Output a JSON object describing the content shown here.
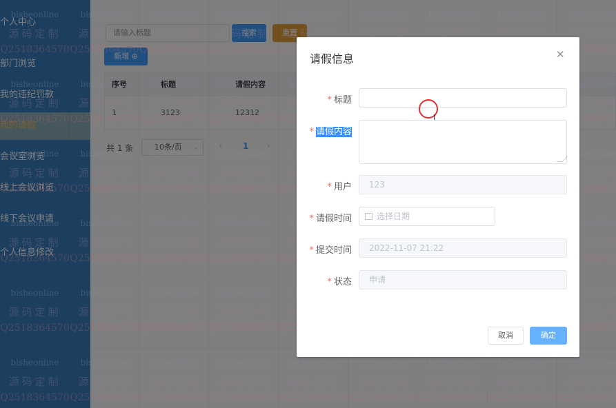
{
  "sidebar": {
    "items": [
      {
        "label": "个人中心"
      },
      {
        "label": "部门浏览"
      },
      {
        "label": "我的违纪罚款"
      },
      {
        "label": "我的请假"
      },
      {
        "label": "会议室浏览"
      },
      {
        "label": "线上会议浏览"
      },
      {
        "label": "线下会议申请"
      },
      {
        "label": "个人信息修改"
      }
    ],
    "active_index": 3
  },
  "toolbar": {
    "search_placeholder": "请输入标题",
    "search_label": "搜索",
    "reset_label": "重置",
    "add_label": "新增",
    "add_icon": "plus-circle-icon"
  },
  "table": {
    "columns": [
      "序号",
      "标题",
      "请假内容"
    ],
    "rows": [
      [
        "1",
        "3123",
        "12312"
      ]
    ]
  },
  "pagination": {
    "total": "共 1 条",
    "page_size": "10条/页",
    "current_page": "1"
  },
  "watermark": {
    "line1": "bisheonline",
    "line2": "源码定制",
    "line3": "Q2518364570"
  },
  "dialog": {
    "title": "请假信息",
    "close_icon": "close-icon",
    "fields": {
      "title": {
        "label": "标题",
        "value": ""
      },
      "content": {
        "label": "请假内容",
        "value": ""
      },
      "user": {
        "label": "用户",
        "value": "123"
      },
      "leave_time": {
        "label": "请假时间",
        "placeholder": "选择日期"
      },
      "submit_time": {
        "label": "提交时间",
        "value": "2022-11-07 21:22"
      },
      "status": {
        "label": "状态",
        "placeholder": "申请"
      }
    },
    "cancel_label": "取消",
    "confirm_label": "确定"
  },
  "colors": {
    "primary": "#409eff",
    "warning": "#e6a23c",
    "required": "#f56c6c",
    "sidebar": "#3a7fbf",
    "selection": "#3390ff"
  }
}
